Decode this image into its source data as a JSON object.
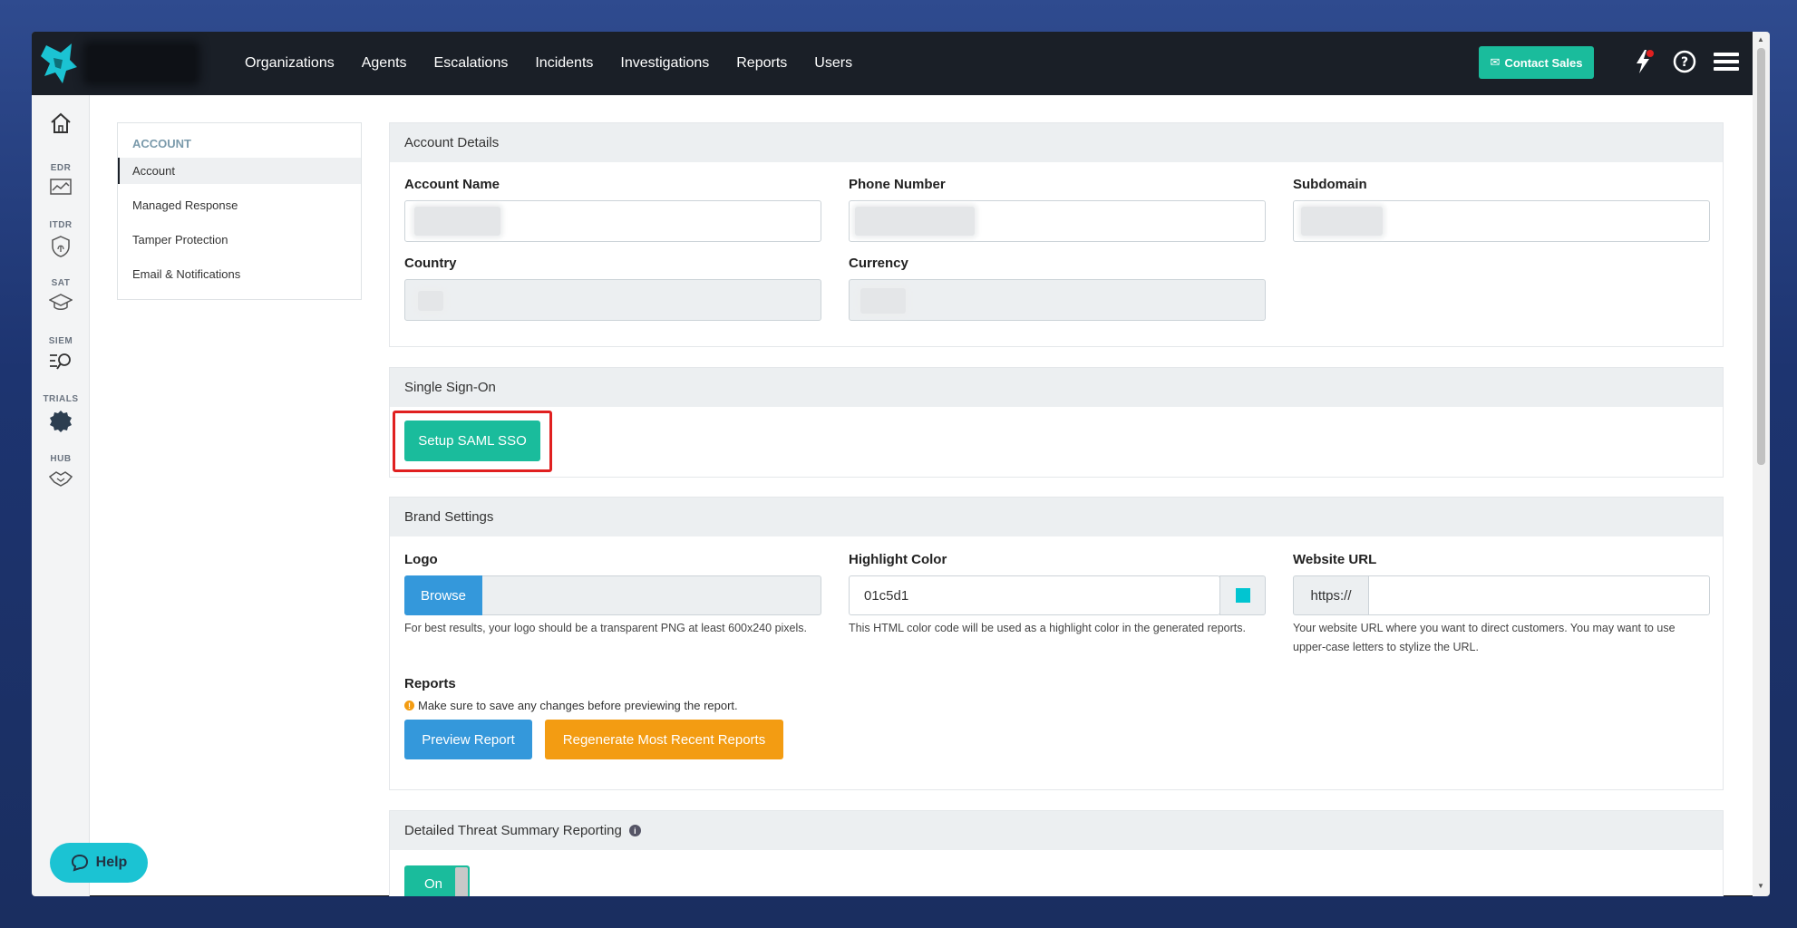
{
  "nav": {
    "items": [
      "Organizations",
      "Agents",
      "Escalations",
      "Incidents",
      "Investigations",
      "Reports",
      "Users"
    ],
    "contact_sales": "Contact Sales"
  },
  "sidebar": {
    "items": [
      {
        "label": "",
        "icon": "home-icon"
      },
      {
        "label": "EDR",
        "icon": "chart-icon"
      },
      {
        "label": "ITDR",
        "icon": "fingerprint-shield-icon"
      },
      {
        "label": "SAT",
        "icon": "graduation-cap-icon"
      },
      {
        "label": "SIEM",
        "icon": "search-list-icon"
      },
      {
        "label": "TRIALS",
        "icon": "badge-icon"
      },
      {
        "label": "HUB",
        "icon": "handshake-icon"
      }
    ],
    "help": "Help"
  },
  "account_menu": {
    "header": "ACCOUNT",
    "items": [
      "Account",
      "Managed Response",
      "Tamper Protection",
      "Email & Notifications"
    ]
  },
  "account_details": {
    "title": "Account Details",
    "account_name_label": "Account Name",
    "phone_label": "Phone Number",
    "subdomain_label": "Subdomain",
    "country_label": "Country",
    "currency_label": "Currency"
  },
  "sso": {
    "title": "Single Sign-On",
    "setup_button": "Setup SAML SSO"
  },
  "brand": {
    "title": "Brand Settings",
    "logo_label": "Logo",
    "browse_button": "Browse",
    "logo_help": "For best results, your logo should be a transparent PNG at least 600x240 pixels.",
    "highlight_label": "Highlight Color",
    "highlight_value": "01c5d1",
    "highlight_swatch": "#01c5d1",
    "highlight_help": "This HTML color code will be used as a highlight color in the generated reports.",
    "website_label": "Website URL",
    "website_prefix": "https://",
    "website_help": "Your website URL where you want to direct customers. You may want to use upper-case letters to stylize the URL.",
    "reports_label": "Reports",
    "reports_note": "Make sure to save any changes before previewing the report.",
    "preview_button": "Preview Report",
    "regenerate_button": "Regenerate Most Recent Reports"
  },
  "threat": {
    "title": "Detailed Threat Summary Reporting",
    "toggle": "On"
  },
  "colors": {
    "accent": "#1abc9c",
    "blue": "#3498db",
    "orange": "#f39c12",
    "highlight_box": "#e02020"
  }
}
